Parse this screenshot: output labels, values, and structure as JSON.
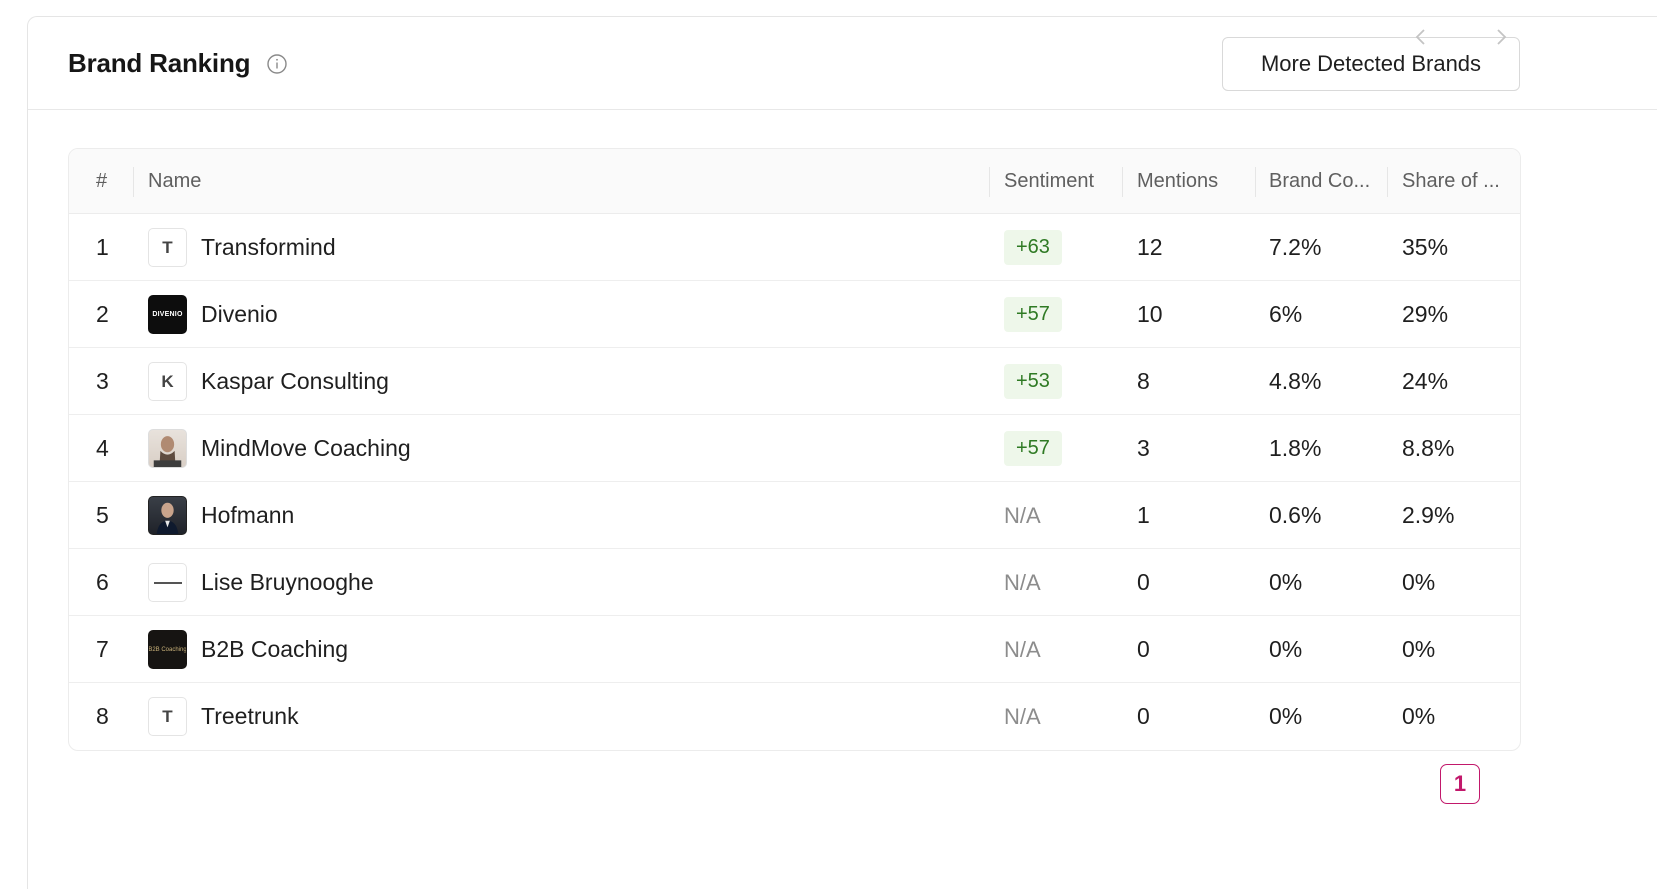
{
  "header": {
    "title": "Brand Ranking",
    "info_icon": "info-circle-icon",
    "more_button_label": "More Detected Brands"
  },
  "table": {
    "columns": {
      "rank": "#",
      "name": "Name",
      "sentiment": "Sentiment",
      "mentions": "Mentions",
      "brand_coverage": "Brand Co...",
      "share": "Share of ..."
    },
    "rows": [
      {
        "rank": "1",
        "logo_letter": "T",
        "logo_type": "letter",
        "name": "Transformind",
        "sentiment": "+63",
        "sentiment_type": "positive",
        "mentions": "12",
        "brand_coverage": "7.2%",
        "share": "35%"
      },
      {
        "rank": "2",
        "logo_letter": "DIVENIO",
        "logo_type": "dark",
        "name": "Divenio",
        "sentiment": "+57",
        "sentiment_type": "positive",
        "mentions": "10",
        "brand_coverage": "6%",
        "share": "29%"
      },
      {
        "rank": "3",
        "logo_letter": "K",
        "logo_type": "letter",
        "name": "Kaspar Consulting",
        "sentiment": "+53",
        "sentiment_type": "positive",
        "mentions": "8",
        "brand_coverage": "4.8%",
        "share": "24%"
      },
      {
        "rank": "4",
        "logo_letter": "",
        "logo_type": "photo1",
        "name": "MindMove Coaching",
        "sentiment": "+57",
        "sentiment_type": "positive",
        "mentions": "3",
        "brand_coverage": "1.8%",
        "share": "8.8%"
      },
      {
        "rank": "5",
        "logo_letter": "",
        "logo_type": "photo2",
        "name": "Hofmann",
        "sentiment": "N/A",
        "sentiment_type": "na",
        "mentions": "1",
        "brand_coverage": "0.6%",
        "share": "2.9%"
      },
      {
        "rank": "6",
        "logo_letter": "",
        "logo_type": "lise",
        "name": "Lise Bruynooghe",
        "sentiment": "N/A",
        "sentiment_type": "na",
        "mentions": "0",
        "brand_coverage": "0%",
        "share": "0%"
      },
      {
        "rank": "7",
        "logo_letter": "B2B Coaching",
        "logo_type": "b2b",
        "name": "B2B Coaching",
        "sentiment": "N/A",
        "sentiment_type": "na",
        "mentions": "0",
        "brand_coverage": "0%",
        "share": "0%"
      },
      {
        "rank": "8",
        "logo_letter": "T",
        "logo_type": "letter",
        "name": "Treetrunk",
        "sentiment": "N/A",
        "sentiment_type": "na",
        "mentions": "0",
        "brand_coverage": "0%",
        "share": "0%"
      }
    ]
  },
  "pagination": {
    "current_page": "1",
    "prev_icon": "chevron-left-icon",
    "next_icon": "chevron-right-icon"
  },
  "colors": {
    "accent": "#c2186b",
    "positive_bg": "#eef7ea",
    "positive_text": "#2f7a24",
    "na_text": "#8c8c8c"
  }
}
